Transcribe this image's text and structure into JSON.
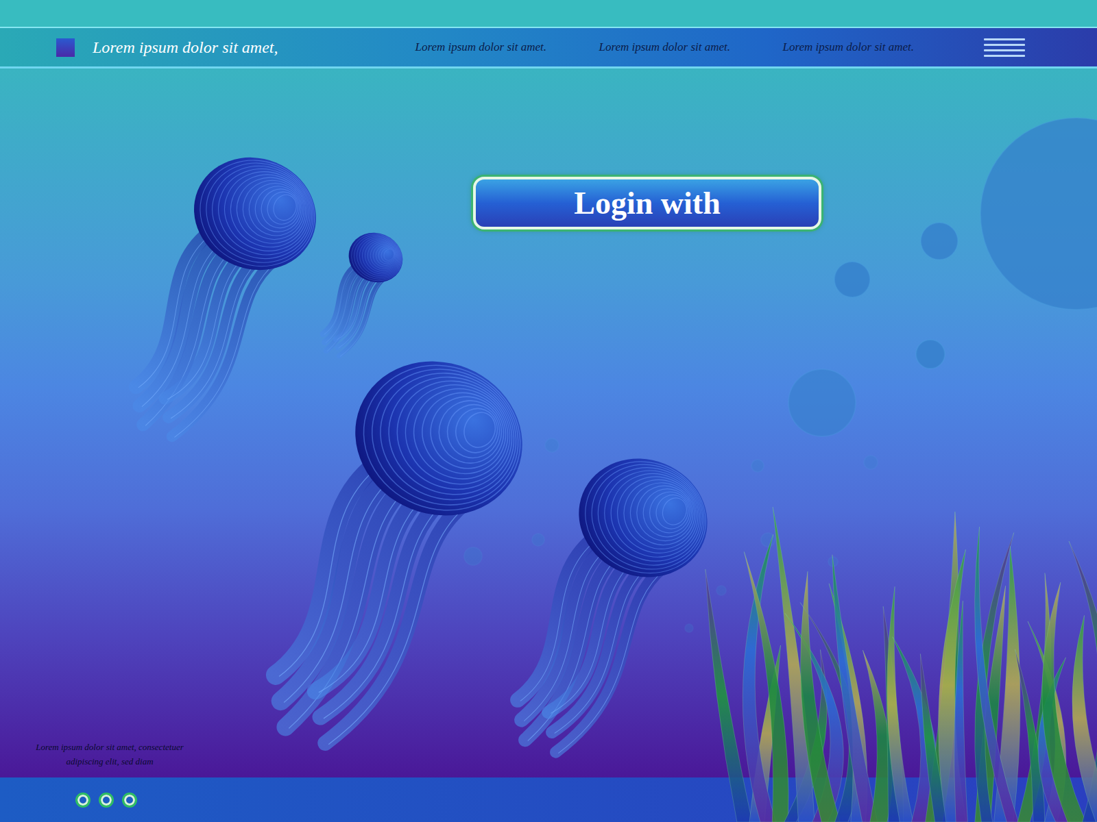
{
  "header": {
    "logo_text": "Lorem ipsum dolor sit amet,",
    "nav": [
      "Lorem ipsum dolor sit amet.",
      "Lorem ipsum dolor sit amet.",
      "Lorem ipsum dolor sit amet."
    ]
  },
  "login_button": {
    "label": "Login with"
  },
  "footer": {
    "text": "Lorem ipsum dolor sit amet, consectetuer adipiscing elit, sed diam",
    "dots": [
      {
        "selected": false
      },
      {
        "selected": false
      },
      {
        "selected": false
      }
    ]
  }
}
